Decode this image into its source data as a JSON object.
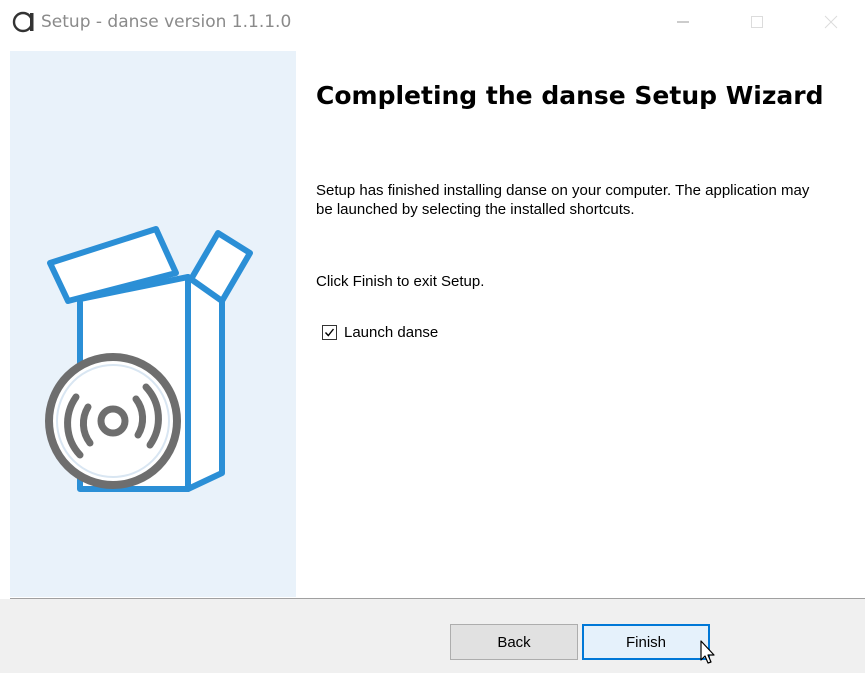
{
  "window": {
    "title": "Setup - danse version 1.1.1.0"
  },
  "content": {
    "heading": "Completing the danse Setup Wizard",
    "description": "Setup has finished installing danse on your computer. The application may be launched by selecting the installed shortcuts.",
    "instruction": "Click Finish to exit Setup.",
    "launch_checkbox": {
      "label": "Launch danse",
      "checked": true
    }
  },
  "buttons": {
    "back_label": "Back",
    "finish_label": "Finish"
  },
  "icons": {
    "app": "app-logo-icon",
    "minimize": "minimize-icon",
    "maximize": "maximize-icon",
    "close": "close-icon",
    "wizard": "install-box-disc-icon",
    "cursor": "mouse-pointer-icon"
  },
  "colors": {
    "side_panel": "#e9f2fa",
    "accent": "#0078d7",
    "box_blue": "#2b8fd6",
    "disc_gray": "#6e6e6e"
  }
}
